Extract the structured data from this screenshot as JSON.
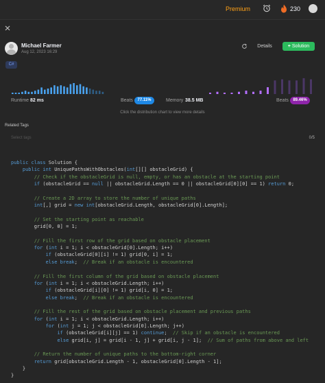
{
  "topbar": {
    "premium": "Premium",
    "streak": "230",
    "colors": {
      "premium": "#ffa116",
      "fire": "#ef6c25"
    }
  },
  "post": {
    "author": "Michael Farmer",
    "date": "Aug 12, 2023 16:29",
    "details_label": "Details",
    "solution_label": "Solution",
    "solution_plus": "+",
    "language": "C#"
  },
  "stats": {
    "runtime_label": "Runtime",
    "runtime_value": "82 ms",
    "runtime_beats_label": "Beats",
    "runtime_beats": "77.11%",
    "memory_label": "Memory",
    "memory_value": "38.5 MB",
    "memory_beats_label": "Beats",
    "memory_beats": "89.46%",
    "hint": "Click the distribution chart to view more details",
    "colors": {
      "runtime": "#4aa3f0",
      "memory": "#b46fff",
      "runtime_dim": "#2f5d84",
      "memory_dim": "#4b3766"
    }
  },
  "chart_data": [
    {
      "type": "bar",
      "name": "Runtime distribution",
      "values": [
        1,
        1,
        1,
        2,
        3,
        2,
        2,
        3,
        4,
        6,
        4,
        5,
        6,
        8,
        7,
        8,
        7,
        6,
        9,
        10,
        8,
        9,
        7,
        6,
        5,
        4,
        3,
        3,
        2
      ],
      "highlight_index": 23
    },
    {
      "type": "bar",
      "name": "Memory distribution",
      "values": [
        1,
        2,
        1,
        1,
        2,
        3,
        2,
        3,
        6,
        12,
        13,
        12,
        12,
        14,
        13
      ],
      "highlight_index": 8
    }
  ],
  "tags": {
    "title": "Related Tags",
    "placeholder": "Select tags",
    "count": "0/5"
  },
  "code": {
    "lines": [
      "public class Solution {",
      "    public int UniquePathsWithObstacles(int[][] obstacleGrid) {",
      "        // Check if the obstacleGrid is null, empty, or has an obstacle at the starting point",
      "        if (obstacleGrid == null || obstacleGrid.Length == 0 || obstacleGrid[0][0] == 1) return 0;",
      "",
      "        // Create a 2D array to store the number of unique paths",
      "        int[,] grid = new int[obstacleGrid.Length, obstacleGrid[0].Length];",
      "",
      "        // Set the starting point as reachable",
      "        grid[0, 0] = 1;",
      "",
      "        // Fill the first row of the grid based on obstacle placement",
      "        for (int i = 1; i < obstacleGrid[0].Length; i++)",
      "            if (obstacleGrid[0][i] != 1) grid[0, i] = 1;",
      "            else break;  // Break if an obstacle is encountered",
      "",
      "        // Fill the first column of the grid based on obstacle placement",
      "        for (int i = 1; i < obstacleGrid.Length; i++)",
      "            if (obstacleGrid[i][0] != 1) grid[i, 0] = 1;",
      "            else break;  // Break if an obstacle is encountered",
      "",
      "        // Fill the rest of the grid based on obstacle placement and previous paths",
      "        for (int i = 1; i < obstacleGrid.Length; i++)",
      "            for (int j = 1; j < obstacleGrid[0].Length; j++)",
      "                if (obstacleGrid[i][j] == 1) continue;  // Skip if an obstacle is encountered",
      "                else grid[i, j] = grid[i - 1, j] + grid[i, j - 1];  // Sum of paths from above and left",
      "",
      "        // Return the number of unique paths to the bottom-right corner",
      "        return grid[obstacleGrid.Length - 1, obstacleGrid[0].Length - 1];",
      "    }",
      "}"
    ],
    "colors": {
      "keyword": "#569cd6",
      "comment": "#6a9955",
      "text": "#d4d4d4"
    }
  }
}
